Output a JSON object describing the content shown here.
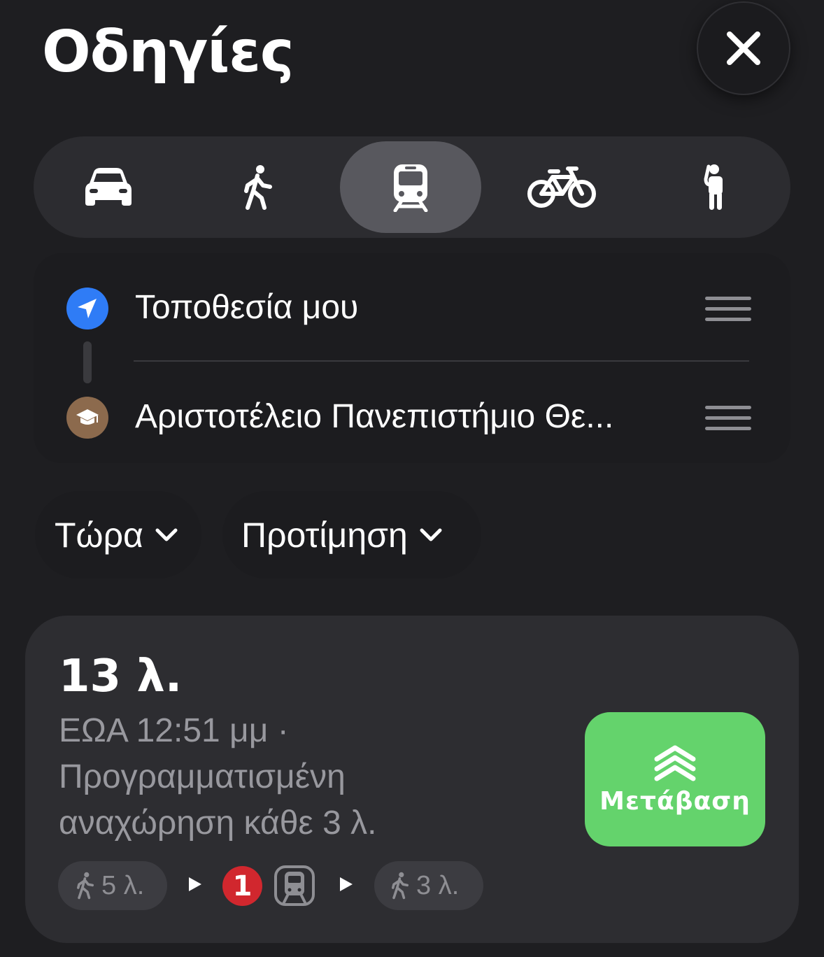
{
  "header": {
    "title": "Οδηγίες",
    "close_icon": "close-icon"
  },
  "transport_modes": [
    {
      "icon": "car-icon",
      "active": false
    },
    {
      "icon": "walk-icon",
      "active": false
    },
    {
      "icon": "train-icon",
      "active": true
    },
    {
      "icon": "bicycle-icon",
      "active": false
    },
    {
      "icon": "rideshare-icon",
      "active": false
    }
  ],
  "route": {
    "origin": {
      "label": "Τοποθεσία μου",
      "icon": "location-arrow-icon"
    },
    "destination": {
      "label": "Αριστοτέλειο Πανεπιστήμιο Θε...",
      "icon": "graduation-cap-icon"
    }
  },
  "options": {
    "time_label": "Τώρα",
    "preference_label": "Προτίμηση"
  },
  "result": {
    "duration": "13 λ.",
    "eta_line": "ΕΩΑ 12:51 μμ ·",
    "schedule_line1": "Προγραμματισμένη",
    "schedule_line2": "αναχώρηση κάθε 3 λ.",
    "go_label": "Μετάβαση",
    "steps": {
      "walk_start": "5 λ.",
      "line_number": "1",
      "walk_end": "3 λ."
    }
  },
  "colors": {
    "go_button": "#64d36c",
    "line_badge": "#d1272e",
    "origin_pin": "#2f7cf6",
    "destination_pin": "#8c6a4d"
  }
}
